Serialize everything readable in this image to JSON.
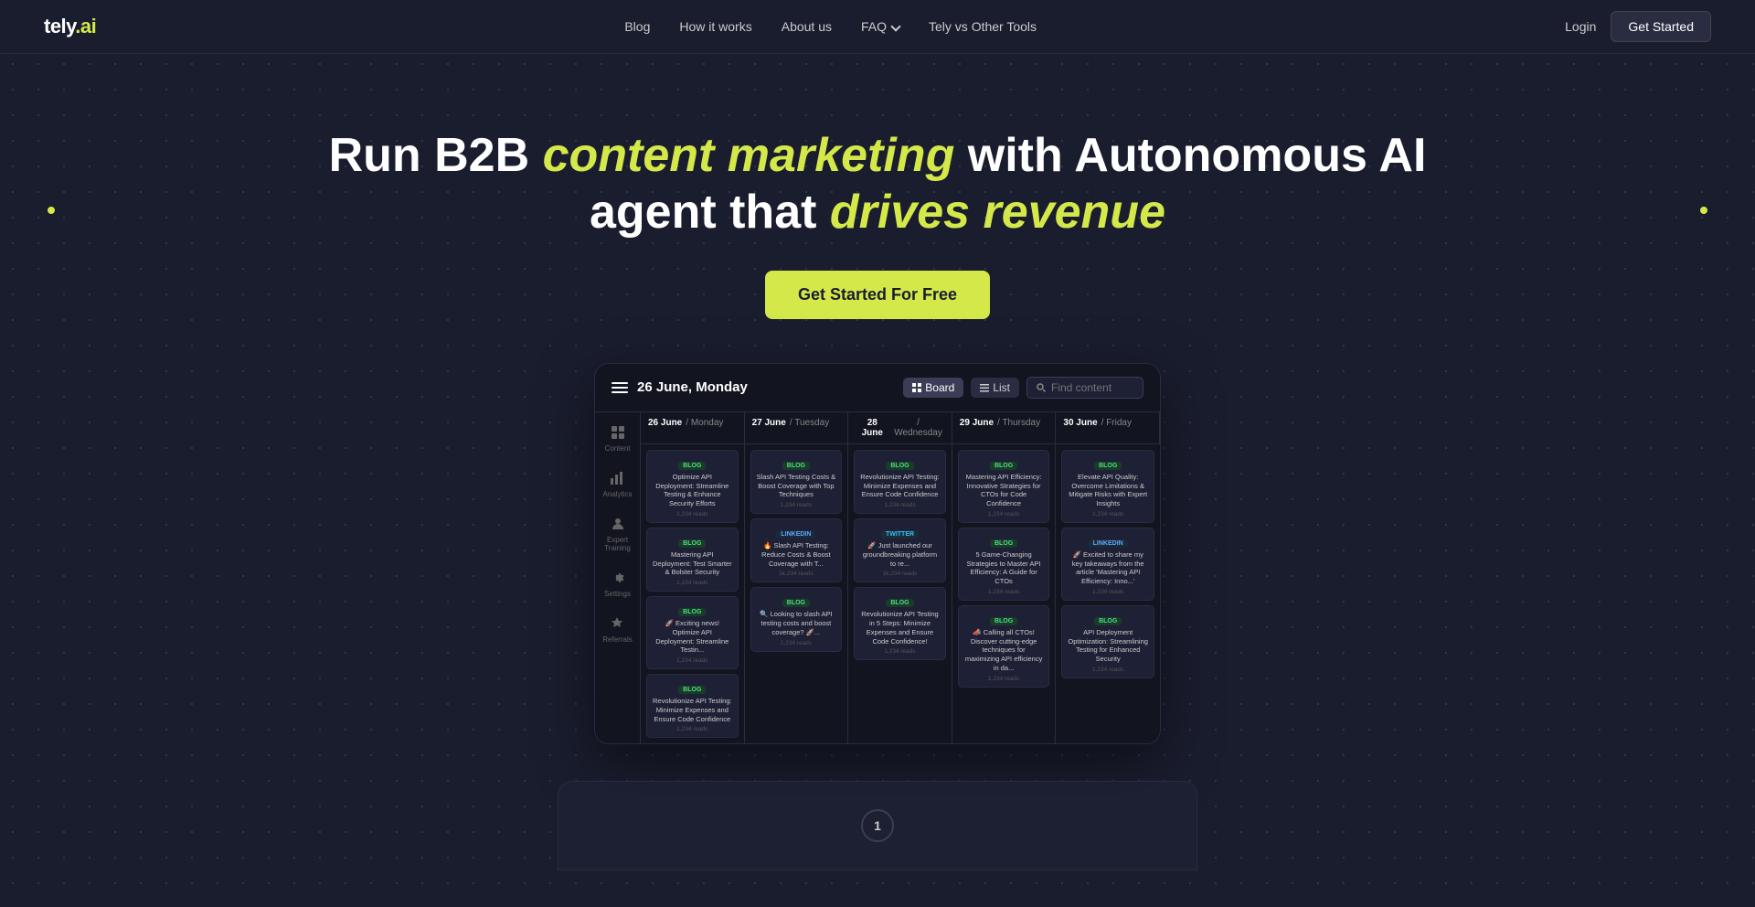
{
  "brand": {
    "logo": "tely.ai"
  },
  "nav": {
    "links": [
      {
        "label": "Blog",
        "id": "blog"
      },
      {
        "label": "How it works",
        "id": "how-it-works"
      },
      {
        "label": "About us",
        "id": "about-us"
      },
      {
        "label": "FAQ",
        "id": "faq"
      },
      {
        "label": "Tely vs Other Tools",
        "id": "tely-vs"
      }
    ],
    "login": "Login",
    "get_started": "Get Started"
  },
  "hero": {
    "title_part1": "Run B2B ",
    "title_highlight": "content marketing",
    "title_part2": " with Autonomous AI",
    "title_line2_part1": "agent that ",
    "title_drives": "drives revenue",
    "cta_label": "Get Started For Free"
  },
  "dashboard": {
    "date": "26 June, Monday",
    "view_board": "Board",
    "view_list": "List",
    "search_placeholder": "Find content",
    "sidebar_items": [
      {
        "label": "Content",
        "icon": "content-icon"
      },
      {
        "label": "Analytics",
        "icon": "analytics-icon"
      },
      {
        "label": "Expert Training",
        "icon": "expert-icon"
      },
      {
        "label": "Settings",
        "icon": "settings-icon"
      },
      {
        "label": "Referrals",
        "icon": "referrals-icon"
      }
    ],
    "columns": [
      {
        "date_num": "26 June",
        "day": "Monday",
        "cards": [
          {
            "tag": "Blog",
            "tag_class": "tag-blog",
            "title": "Optimize API Deployment: Streamline Testing & Enhance Security Efforts",
            "meta": "1,234 reads"
          },
          {
            "tag": "Blog",
            "tag_class": "tag-blog",
            "title": "Mastering API Deployment: Test Smarter & Bolster Security",
            "meta": "1,234 reads"
          },
          {
            "tag": "Blog",
            "tag_class": "tag-blog",
            "title": "🚀 Exciting news! Optimize API Deployment: Streamline Testin...",
            "meta": "1,234 reads"
          },
          {
            "tag": "Blog",
            "tag_class": "tag-blog",
            "title": "Revolutionize API Testing: Minimize Expenses and Ensure Code Confidence",
            "meta": "1,234 reads"
          }
        ]
      },
      {
        "date_num": "27 June",
        "day": "Tuesday",
        "cards": [
          {
            "tag": "Blog",
            "tag_class": "tag-blog",
            "title": "Slash API Testing Costs & Boost Coverage with Top Techniques",
            "meta": "1,234 reads"
          },
          {
            "tag": "LinkedIn",
            "tag_class": "tag-linkedin",
            "title": "🔥 Slash API Testing: Reduce Costs & Boost Coverage with T...",
            "meta": "1k,234 reads"
          },
          {
            "tag": "Blog",
            "tag_class": "tag-blog",
            "title": "🔍 Looking to slash API testing costs and boost coverage? 🚀...",
            "meta": "1,234 reads"
          }
        ]
      },
      {
        "date_num": "28 June",
        "day": "Wednesday",
        "cards": [
          {
            "tag": "Blog",
            "tag_class": "tag-blog",
            "title": "Revolutionize API Testing: Minimize Expenses and Ensure Code Confidence",
            "meta": "1,234 reads"
          },
          {
            "tag": "Twitter",
            "tag_class": "tag-twitter",
            "title": "🚀 Just launched our groundbreaking platform to re...",
            "meta": "1k,234 reads"
          },
          {
            "tag": "Blog",
            "tag_class": "tag-blog",
            "title": "Revolutionize API Testing in 5 Steps: Minimize Expenses and Ensure Code Confidence!",
            "meta": "1,234 reads"
          }
        ]
      },
      {
        "date_num": "29 June",
        "day": "Thursday",
        "cards": [
          {
            "tag": "Blog",
            "tag_class": "tag-blog",
            "title": "Mastering API Efficiency: Innovative Strategies for CTOs for Code Confidence",
            "meta": "1,234 reads"
          },
          {
            "tag": "Blog",
            "tag_class": "tag-blog",
            "title": "5 Game-Changing Strategies to Master API Efficiency: A Guide for CTOs",
            "meta": "1,234 reads"
          },
          {
            "tag": "Blog",
            "tag_class": "tag-blog",
            "title": "📣 Calling all CTOs! Discover cutting-edge techniques for maximizing API efficiency in da...",
            "meta": "1,234 reads"
          }
        ]
      },
      {
        "date_num": "30 June",
        "day": "Friday",
        "cards": [
          {
            "tag": "Blog",
            "tag_class": "tag-blog",
            "title": "Elevate API Quality: Overcome Limitations & Mitigate Risks with Expert Insights",
            "meta": "1,234 reads"
          },
          {
            "tag": "LinkedIn",
            "tag_class": "tag-linkedin",
            "title": "🚀 Excited to share my key takeaways from the article 'Mastering API Efficiency: Inno...'",
            "meta": "1,234 reads"
          },
          {
            "tag": "Blog",
            "tag_class": "tag-blog",
            "title": "API Deployment Optimization: Streamlining Testing for Enhanced Security",
            "meta": "1,234 reads"
          }
        ]
      }
    ]
  },
  "bottom": {
    "step_number": "1"
  }
}
